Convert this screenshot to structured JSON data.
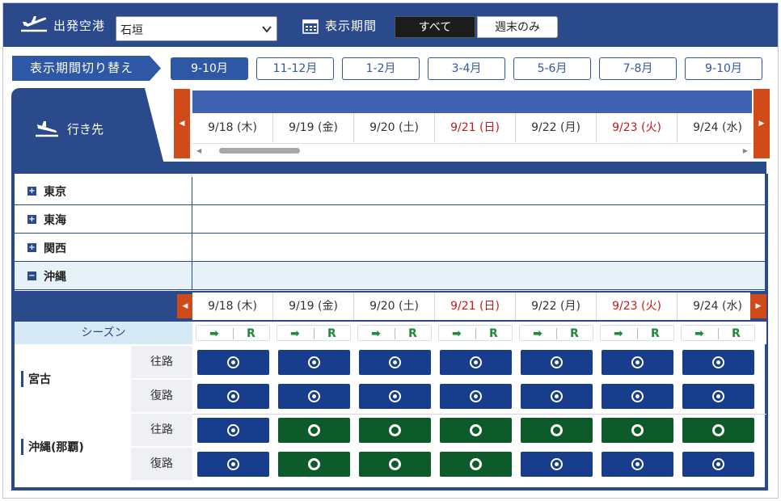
{
  "header": {
    "departure_label": "出発空港",
    "departure_value": "石垣",
    "period_label": "表示期間",
    "filter_all": "すべて",
    "filter_weekend": "週末のみ"
  },
  "period_switch": {
    "label": "表示期間切り替え",
    "tabs": [
      "9-10月",
      "11-12月",
      "1-2月",
      "3-4月",
      "5-6月",
      "7-8月",
      "9-10月"
    ],
    "active_index": 0
  },
  "destination_header": {
    "label": "行き先"
  },
  "dates": [
    {
      "label": "9/18 (木)",
      "holiday": false
    },
    {
      "label": "9/19 (金)",
      "holiday": false
    },
    {
      "label": "9/20 (土)",
      "holiday": false
    },
    {
      "label": "9/21 (日)",
      "holiday": true
    },
    {
      "label": "9/22 (月)",
      "holiday": false
    },
    {
      "label": "9/23 (火)",
      "holiday": true
    },
    {
      "label": "9/24 (水)",
      "holiday": false
    }
  ],
  "regions": [
    {
      "name": "東京",
      "expanded": false
    },
    {
      "name": "東海",
      "expanded": false
    },
    {
      "name": "関西",
      "expanded": false
    },
    {
      "name": "沖縄",
      "expanded": true
    }
  ],
  "season": {
    "label": "シーズン",
    "arrow": "➡",
    "r": "R"
  },
  "destinations": [
    {
      "name": "宮古",
      "rows": [
        {
          "direction": "往路",
          "cells": [
            "dot",
            "dot",
            "dot",
            "dot",
            "dot",
            "dot",
            "dot"
          ],
          "colors": [
            "blue",
            "blue",
            "blue",
            "blue",
            "blue",
            "blue",
            "blue"
          ]
        },
        {
          "direction": "復路",
          "cells": [
            "dot",
            "dot",
            "dot",
            "dot",
            "dot",
            "dot",
            "dot"
          ],
          "colors": [
            "blue",
            "blue",
            "blue",
            "blue",
            "blue",
            "blue",
            "blue"
          ]
        }
      ]
    },
    {
      "name": "沖縄(那覇)",
      "rows": [
        {
          "direction": "往路",
          "cells": [
            "dot",
            "ring",
            "ring",
            "ring",
            "ring",
            "ring",
            "ring"
          ],
          "colors": [
            "blue",
            "green",
            "green",
            "green",
            "green",
            "green",
            "green"
          ]
        },
        {
          "direction": "復路",
          "cells": [
            "dot",
            "ring",
            "ring",
            "ring",
            "dot",
            "dot",
            "dot"
          ],
          "colors": [
            "blue",
            "green",
            "green",
            "green",
            "blue",
            "blue",
            "blue"
          ]
        }
      ]
    }
  ],
  "colors": {
    "primary": "#2b4a8c",
    "accent_orange": "#d14a1a",
    "holiday_red": "#c81a1a",
    "cell_blue": "#173d8c",
    "cell_green": "#0d5a2b",
    "season_green": "#1e8a3a"
  }
}
